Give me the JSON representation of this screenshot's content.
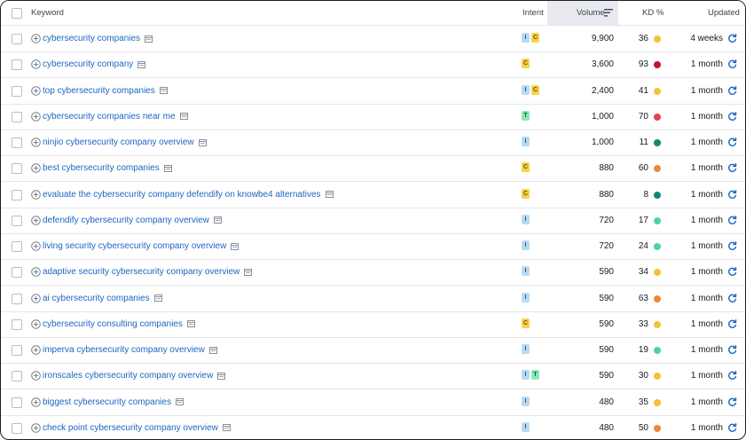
{
  "header": {
    "keyword": "Keyword",
    "intent": "Intent",
    "volume": "Volume",
    "kd": "KD %",
    "updated": "Updated"
  },
  "colors": {
    "link": "#1a66c2",
    "kd_yellow": "#f5c133",
    "kd_orange": "#f0883a",
    "kd_red": "#e8414c",
    "kd_darkred": "#c8102e",
    "kd_teal": "#0e8a74",
    "kd_green": "#4cd69a"
  },
  "rows": [
    {
      "keyword": "cybersecurity companies",
      "intents": [
        "I",
        "C"
      ],
      "volume": "9,900",
      "kd": "36",
      "kd_color": "#f5c133",
      "updated": "4 weeks"
    },
    {
      "keyword": "cybersecurity company",
      "intents": [
        "C"
      ],
      "volume": "3,600",
      "kd": "93",
      "kd_color": "#c8102e",
      "updated": "1 month"
    },
    {
      "keyword": "top cybersecurity companies",
      "intents": [
        "I",
        "C"
      ],
      "volume": "2,400",
      "kd": "41",
      "kd_color": "#f5c133",
      "updated": "1 month"
    },
    {
      "keyword": "cybersecurity companies near me",
      "intents": [
        "T"
      ],
      "volume": "1,000",
      "kd": "70",
      "kd_color": "#e8414c",
      "updated": "1 month"
    },
    {
      "keyword": "ninjio cybersecurity company overview",
      "intents": [
        "I"
      ],
      "volume": "1,000",
      "kd": "11",
      "kd_color": "#0e8a74",
      "updated": "1 month"
    },
    {
      "keyword": "best cybersecurity companies",
      "intents": [
        "C"
      ],
      "volume": "880",
      "kd": "60",
      "kd_color": "#f0883a",
      "updated": "1 month"
    },
    {
      "keyword": "evaluate the cybersecurity company defendify on knowbe4 alternatives",
      "intents": [
        "C"
      ],
      "volume": "880",
      "kd": "8",
      "kd_color": "#0e8a74",
      "updated": "1 month"
    },
    {
      "keyword": "defendify cybersecurity company overview",
      "intents": [
        "I"
      ],
      "volume": "720",
      "kd": "17",
      "kd_color": "#4cd69a",
      "updated": "1 month"
    },
    {
      "keyword": "living security cybersecurity company overview",
      "intents": [
        "I"
      ],
      "volume": "720",
      "kd": "24",
      "kd_color": "#4cd69a",
      "updated": "1 month"
    },
    {
      "keyword": "adaptive security cybersecurity company overview",
      "intents": [
        "I"
      ],
      "volume": "590",
      "kd": "34",
      "kd_color": "#f5c133",
      "updated": "1 month"
    },
    {
      "keyword": "ai cybersecurity companies",
      "intents": [
        "I"
      ],
      "volume": "590",
      "kd": "63",
      "kd_color": "#f0883a",
      "updated": "1 month"
    },
    {
      "keyword": "cybersecurity consulting companies",
      "intents": [
        "C"
      ],
      "volume": "590",
      "kd": "33",
      "kd_color": "#f5c133",
      "updated": "1 month"
    },
    {
      "keyword": "imperva cybersecurity company overview",
      "intents": [
        "I"
      ],
      "volume": "590",
      "kd": "19",
      "kd_color": "#4cd69a",
      "updated": "1 month"
    },
    {
      "keyword": "ironscales cybersecurity company overview",
      "intents": [
        "I",
        "T"
      ],
      "volume": "590",
      "kd": "30",
      "kd_color": "#f5c133",
      "updated": "1 month"
    },
    {
      "keyword": "biggest cybersecurity companies",
      "intents": [
        "I"
      ],
      "volume": "480",
      "kd": "35",
      "kd_color": "#f5c133",
      "updated": "1 month"
    },
    {
      "keyword": "check point cybersecurity company overview",
      "intents": [
        "I"
      ],
      "volume": "480",
      "kd": "50",
      "kd_color": "#f0883a",
      "updated": "1 month"
    }
  ]
}
